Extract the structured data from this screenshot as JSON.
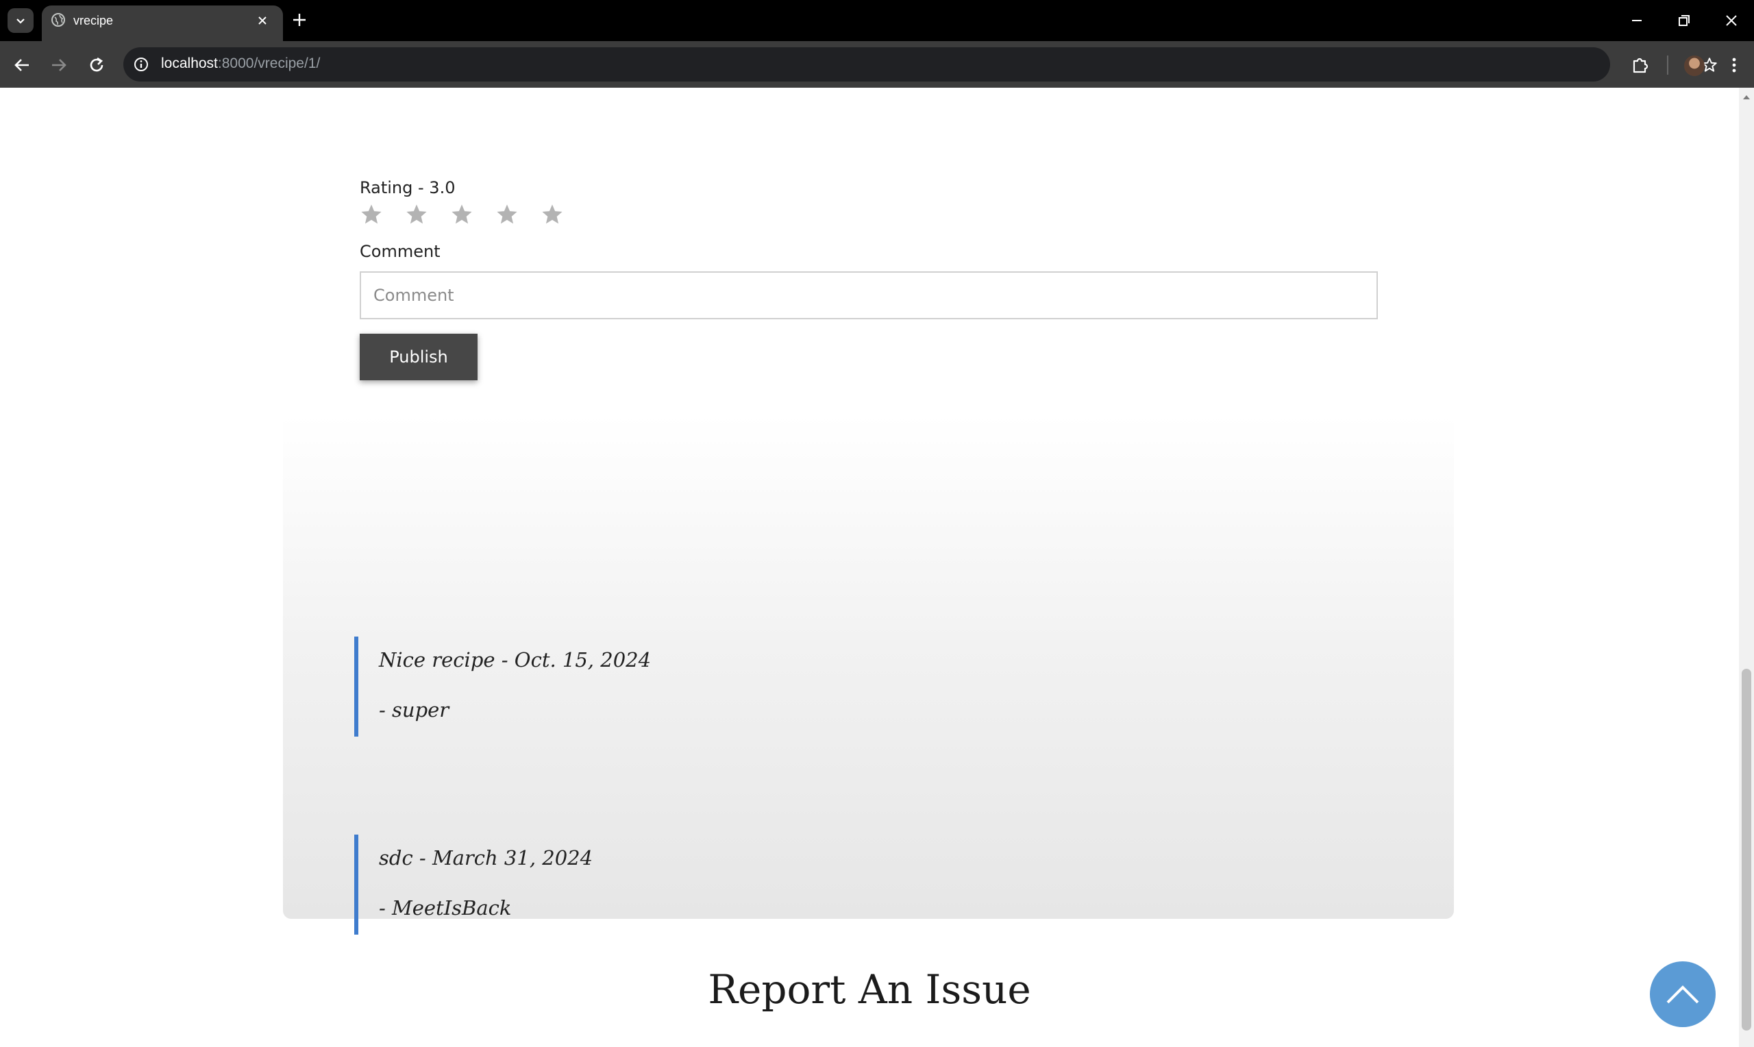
{
  "browser": {
    "tab_title": "vrecipe",
    "url_host": "localhost",
    "url_rest": ":8000/vrecipe/1/"
  },
  "review_form": {
    "rating_label": "Rating - 3.0",
    "rating_value": 3.0,
    "rating_max": 5,
    "comment_label": "Comment",
    "comment_placeholder": "Comment",
    "publish_label": "Publish"
  },
  "comments": [
    {
      "text": "Nice recipe",
      "separator": " - ",
      "date": "Oct. 15, 2024",
      "author": "- super"
    },
    {
      "text": "sdc",
      "separator": " - ",
      "date": "March 31, 2024",
      "author": "- MeetIsBack"
    }
  ],
  "report": {
    "title": "Report An Issue"
  },
  "colors": {
    "accent_border": "#3f7ccd",
    "publish_bg": "#474747",
    "back_to_top_bg": "#5b9bd5",
    "star_color": "#b3b3b3"
  },
  "icons": {
    "back_to_top": "chevron-up-icon"
  }
}
